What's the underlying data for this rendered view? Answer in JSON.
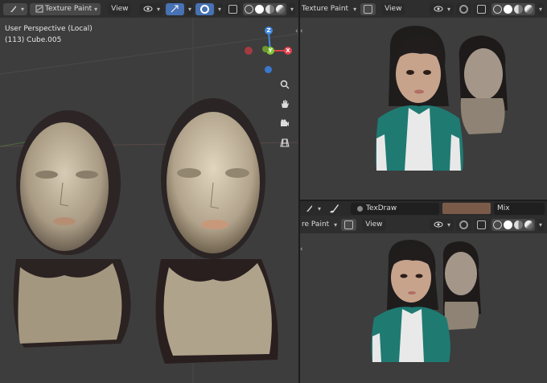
{
  "left_viewport": {
    "mode_label": "Texture Paint",
    "view_label": "View",
    "perspective_text": "User Perspective (Local)",
    "object_text": "(113) Cube.005",
    "gizmo": {
      "z": "Z",
      "x": "X",
      "y": "Y"
    },
    "tools": [
      "zoom-icon",
      "hand-pan-icon",
      "camera-icon",
      "grid-ortho-icon"
    ]
  },
  "top_right_viewport": {
    "mode_label": "Texture Paint",
    "view_label": "View"
  },
  "bottom_right_tool_header": {
    "brush_name": "TexDraw",
    "color_swatch": "#7a5b4a",
    "blend_mode": "Mix"
  },
  "bottom_right_viewport": {
    "mode_label": "re Paint",
    "view_label": "View"
  },
  "colors": {
    "header_bg": "#2e2e2e",
    "viewport_bg": "#3d3d3d",
    "accent_blue": "#4772b3",
    "axis_x": "#e0424d",
    "axis_y": "#86c53a",
    "axis_z": "#3f86df"
  }
}
